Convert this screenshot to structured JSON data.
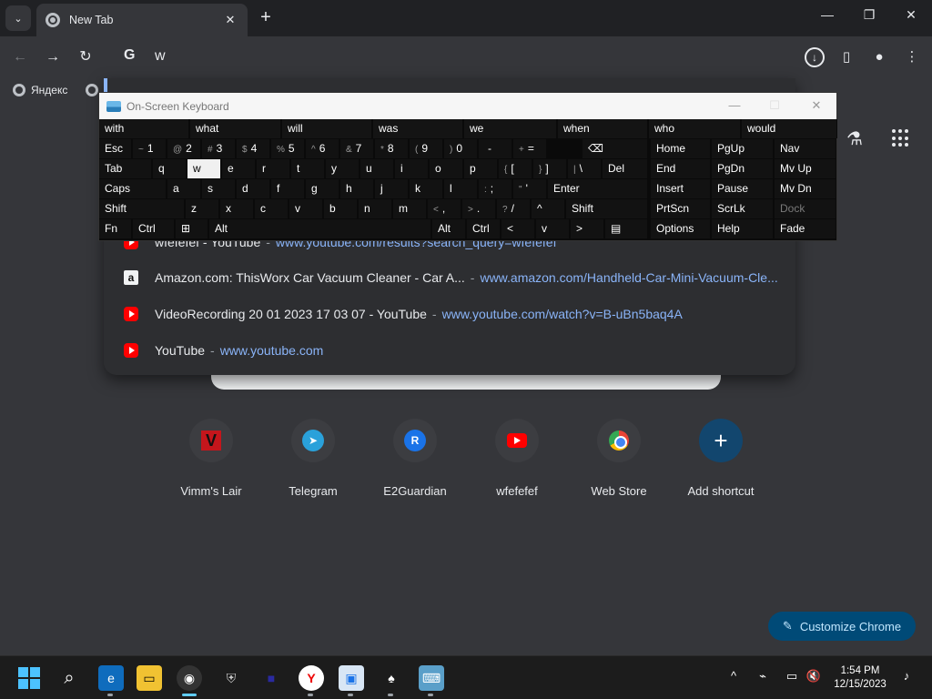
{
  "window": {
    "tab_title": "New Tab"
  },
  "toolbar": {
    "omnibox_value": "w",
    "omnibox_prefix": "G"
  },
  "bookmarks": {
    "items": [
      {
        "label": "Яндекс"
      }
    ]
  },
  "dropdown": {
    "suggestions": [
      {
        "icon": "youtube-icon",
        "title": "wfefefef - YouTube",
        "sep": "-",
        "url": "www.youtube.com/results?search_query=wfefefef"
      },
      {
        "icon": "amazon-icon",
        "title": "Amazon.com: ThisWorx Car Vacuum Cleaner - Car A...",
        "sep": "-",
        "url": "www.amazon.com/Handheld-Car-Mini-Vacuum-Cle..."
      },
      {
        "icon": "youtube-icon",
        "title": "VideoRecording 20 01 2023 17 03 07 - YouTube",
        "sep": "-",
        "url": "www.youtube.com/watch?v=B-uBn5baq4A"
      },
      {
        "icon": "youtube-icon",
        "title": "YouTube",
        "sep": "-",
        "url": "www.youtube.com"
      }
    ]
  },
  "shortcuts": [
    {
      "label": "Vimm's Lair",
      "icon": "V"
    },
    {
      "label": "Telegram",
      "icon": "➤"
    },
    {
      "label": "E2Guardian",
      "icon": "R"
    },
    {
      "label": "wfefefef",
      "icon": "youtube-icon"
    },
    {
      "label": "Web Store",
      "icon": "webstore-icon"
    },
    {
      "label": "Add shortcut",
      "icon": "+"
    }
  ],
  "customize": {
    "label": "Customize Chrome"
  },
  "taskbar": {
    "time": "1:54 PM",
    "date": "12/15/2023"
  },
  "osk": {
    "title": "On-Screen Keyboard",
    "predictions": [
      "with",
      "what",
      "will",
      "was",
      "we",
      "when",
      "who",
      "would"
    ],
    "row1": [
      "Esc",
      "~",
      "1",
      "@",
      "2",
      "#",
      "3",
      "$",
      "4",
      "%",
      "5",
      "^",
      "6",
      "&",
      "7",
      "*",
      "8",
      "(",
      "9",
      ")",
      "0",
      "-",
      "+",
      "="
    ],
    "row2": [
      "Tab",
      "q",
      "w",
      "e",
      "r",
      "t",
      "y",
      "u",
      "i",
      "o",
      "p",
      "{",
      "[",
      "}",
      "]",
      "|",
      "\\",
      "Del"
    ],
    "row3": [
      "Caps",
      "a",
      "s",
      "d",
      "f",
      "g",
      "h",
      "j",
      "k",
      "l",
      ":",
      ";",
      "\"",
      "'",
      "Enter"
    ],
    "row4": [
      "Shift",
      "z",
      "x",
      "c",
      "v",
      "b",
      "n",
      "m",
      "<",
      ",",
      ">",
      ".",
      "?",
      "/",
      "^",
      "Shift"
    ],
    "row5": [
      "Fn",
      "Ctrl",
      "Alt",
      "Alt",
      "Ctrl",
      "<",
      "v",
      ">"
    ],
    "nav": [
      "Home",
      "PgUp",
      "Nav",
      "End",
      "PgDn",
      "Mv Up",
      "Insert",
      "Pause",
      "Mv Dn",
      "PrtScn",
      "ScrLk",
      "Dock",
      "Options",
      "Help",
      "Fade"
    ]
  }
}
